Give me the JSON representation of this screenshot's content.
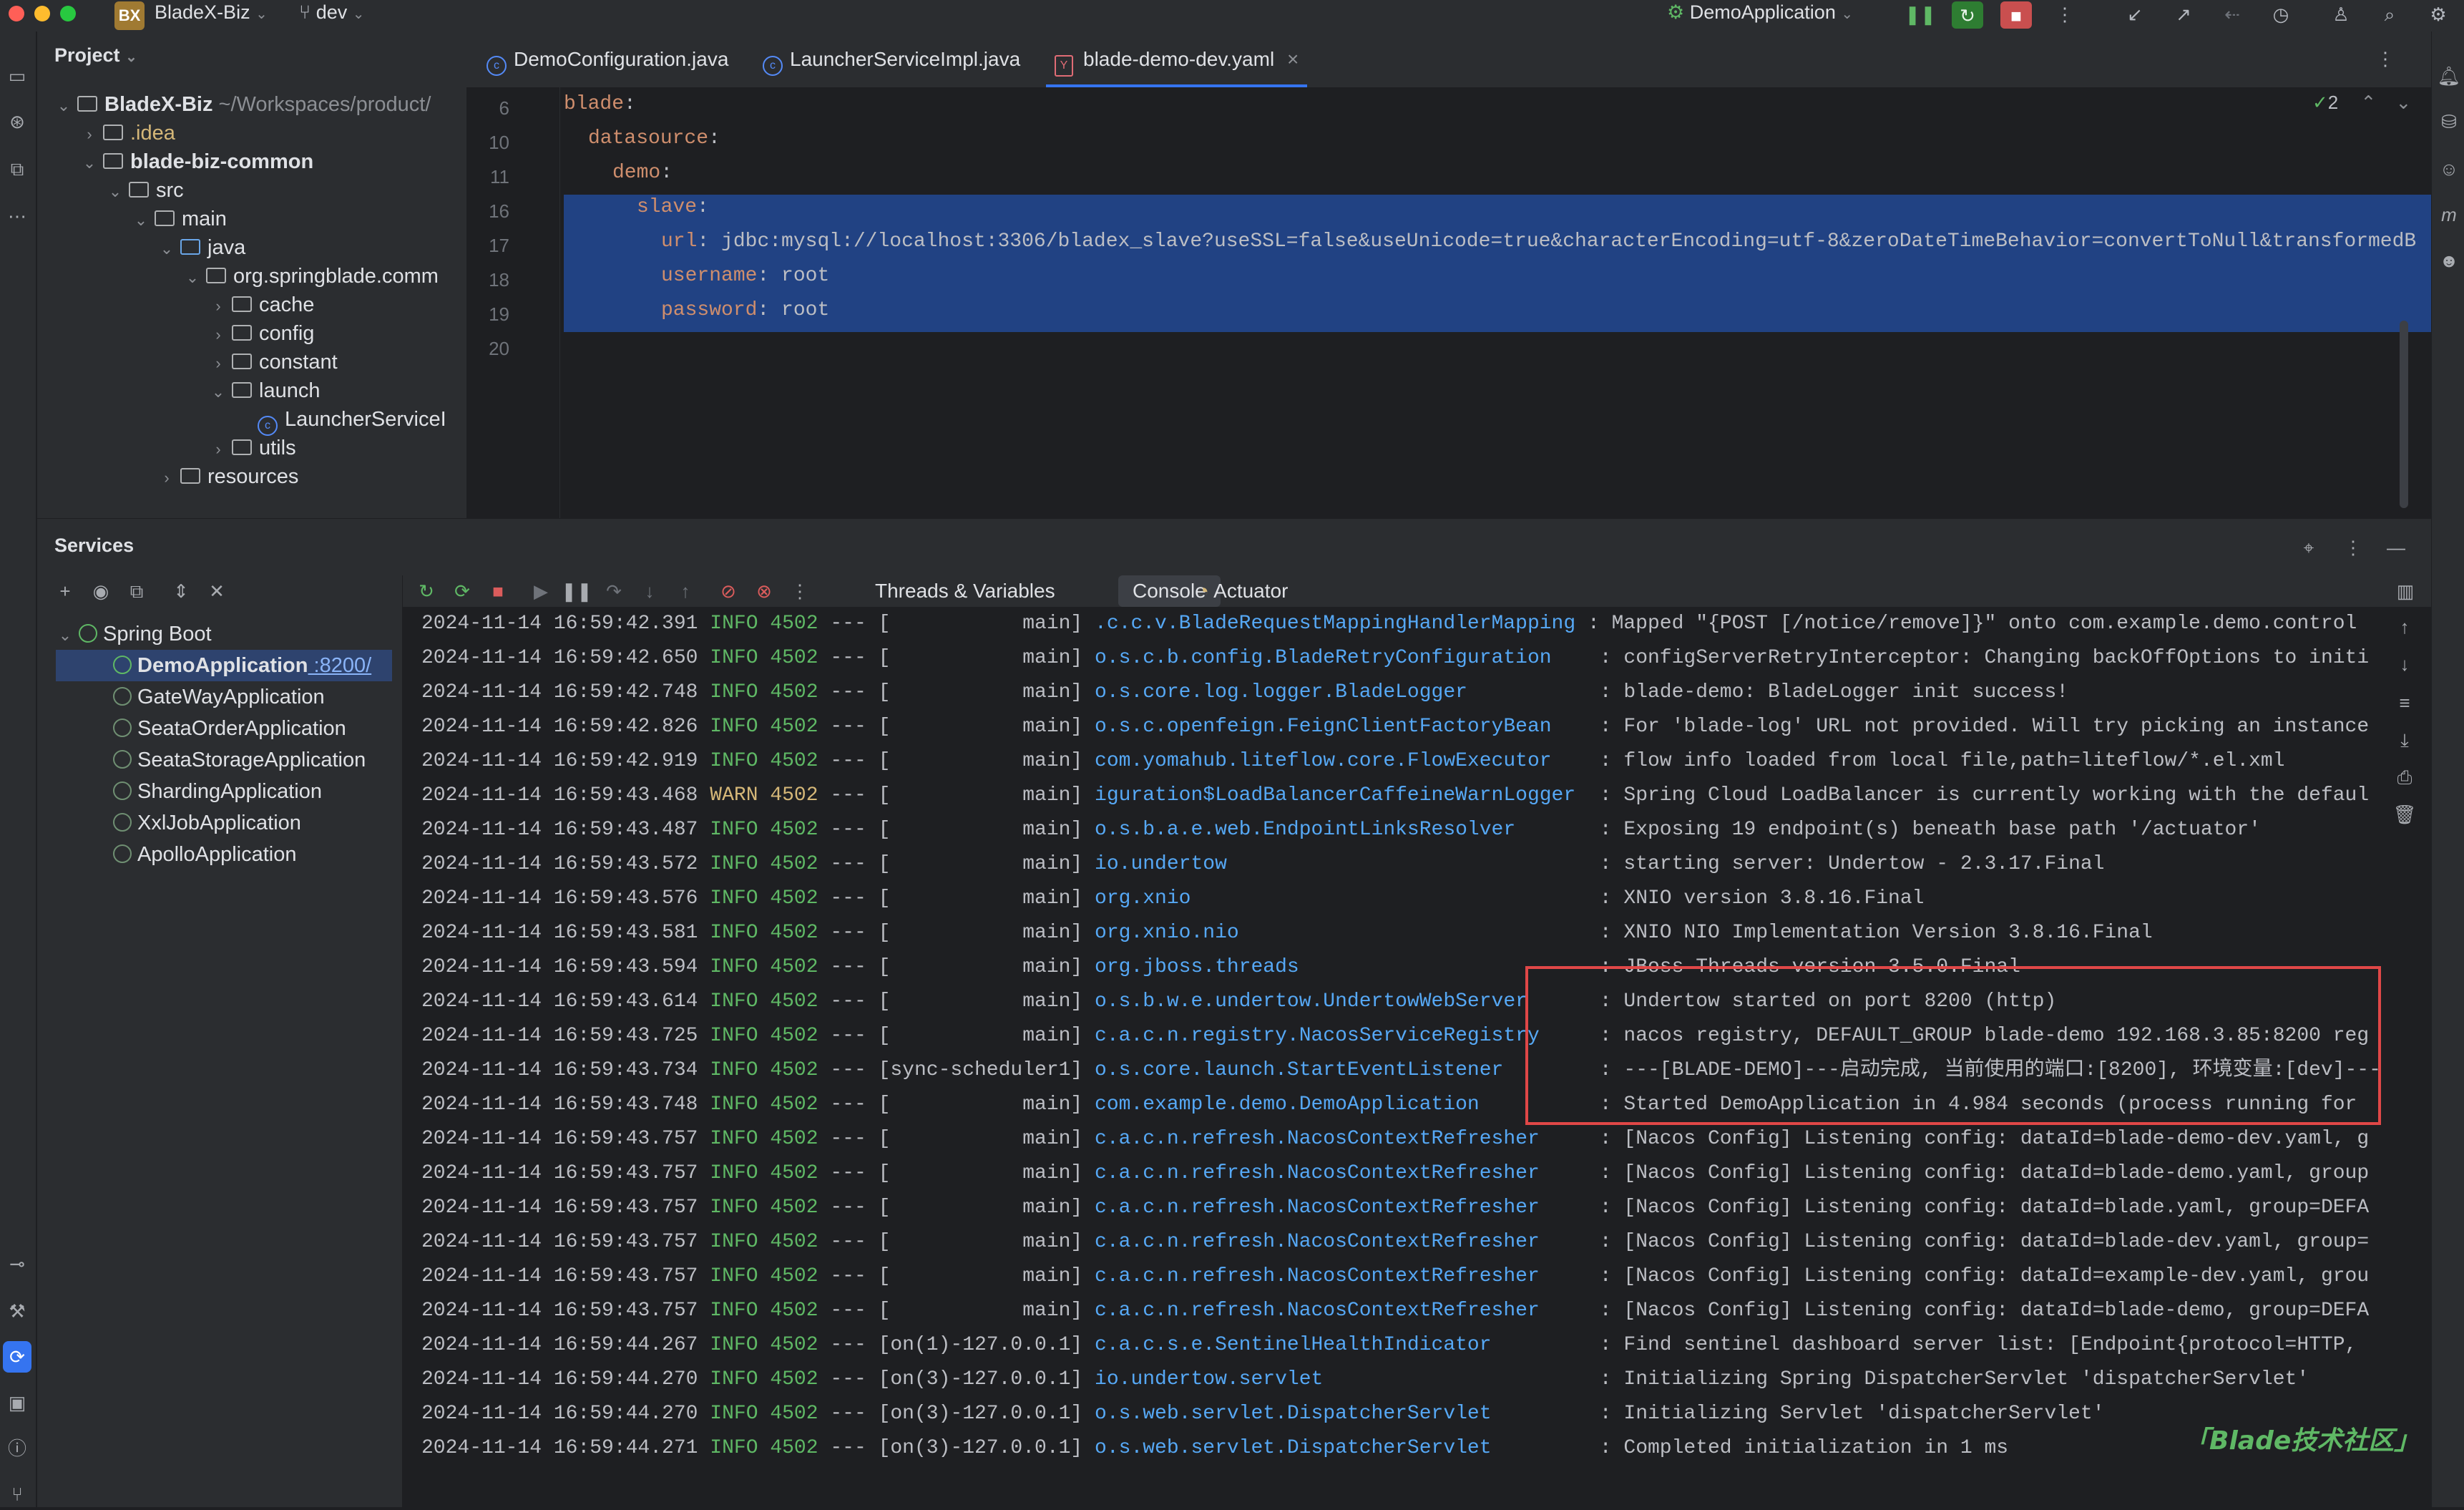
{
  "titlebar": {
    "project_badge": "BX",
    "project_name": "BladeX-Biz",
    "branch": "dev",
    "run_config": "DemoApplication"
  },
  "colors": {
    "accent": "#3574f0",
    "selection": "#214283",
    "info": "#5fb865",
    "warn": "#d5b778",
    "link": "#56a8f5",
    "highlight_box": "#e04747"
  },
  "project": {
    "title": "Project",
    "tree": [
      {
        "label": "BladeX-Biz",
        "suffix": "~/Workspaces/product/",
        "level": 0,
        "kind": "module",
        "expanded": true
      },
      {
        "label": ".idea",
        "level": 1,
        "kind": "folder",
        "expanded": false
      },
      {
        "label": "blade-biz-common",
        "level": 1,
        "kind": "module",
        "expanded": true
      },
      {
        "label": "src",
        "level": 2,
        "kind": "folder",
        "expanded": true
      },
      {
        "label": "main",
        "level": 3,
        "kind": "folder",
        "expanded": true
      },
      {
        "label": "java",
        "level": 4,
        "kind": "source",
        "expanded": true
      },
      {
        "label": "org.springblade.comm",
        "level": 5,
        "kind": "package",
        "expanded": true
      },
      {
        "label": "cache",
        "level": 6,
        "kind": "package",
        "expanded": false
      },
      {
        "label": "config",
        "level": 6,
        "kind": "package",
        "expanded": false
      },
      {
        "label": "constant",
        "level": 6,
        "kind": "package",
        "expanded": false
      },
      {
        "label": "launch",
        "level": 6,
        "kind": "package",
        "expanded": true
      },
      {
        "label": "LauncherServiceI",
        "level": 7,
        "kind": "class",
        "expanded": null
      },
      {
        "label": "utils",
        "level": 6,
        "kind": "package",
        "expanded": false
      },
      {
        "label": "resources",
        "level": 4,
        "kind": "folder",
        "expanded": false
      }
    ]
  },
  "editor": {
    "tabs": [
      {
        "label": "DemoConfiguration.java",
        "active": false
      },
      {
        "label": "LauncherServiceImpl.java",
        "active": false
      },
      {
        "label": "blade-demo-dev.yaml",
        "active": true
      }
    ],
    "inspection_count": "2",
    "lines": [
      {
        "num": "6",
        "key": "blade",
        "value": "",
        "indent": 0,
        "selected": false
      },
      {
        "num": "10",
        "key": "datasource",
        "value": "",
        "indent": 1,
        "selected": false
      },
      {
        "num": "11",
        "key": "demo",
        "value": "",
        "indent": 2,
        "selected": false
      },
      {
        "num": "16",
        "key": "slave",
        "value": "",
        "indent": 3,
        "selected": true
      },
      {
        "num": "17",
        "key": "url",
        "value": "jdbc:mysql://localhost:3306/bladex_slave?useSSL=false&useUnicode=true&characterEncoding=utf-8&zeroDateTimeBehavior=convertToNull&transformedB",
        "indent": 4,
        "selected": true
      },
      {
        "num": "18",
        "key": "username",
        "value": "root",
        "indent": 4,
        "selected": true
      },
      {
        "num": "19",
        "key": "password",
        "value": "root",
        "indent": 4,
        "selected": true
      },
      {
        "num": "20",
        "key": "",
        "value": "",
        "indent": 0,
        "selected": false
      }
    ]
  },
  "services": {
    "title": "Services",
    "group": "Spring Boot",
    "apps": [
      {
        "name": "DemoApplication",
        "port": ":8200/",
        "selected": true,
        "running": true
      },
      {
        "name": "GateWayApplication",
        "port": "",
        "selected": false,
        "running": false
      },
      {
        "name": "SeataOrderApplication",
        "port": "",
        "selected": false,
        "running": false
      },
      {
        "name": "SeataStorageApplication",
        "port": "",
        "selected": false,
        "running": false
      },
      {
        "name": "ShardingApplication",
        "port": "",
        "selected": false,
        "running": false
      },
      {
        "name": "XxlJobApplication",
        "port": "",
        "selected": false,
        "running": false
      },
      {
        "name": "ApolloApplication",
        "port": "",
        "selected": false,
        "running": false
      }
    ],
    "console_tabs": [
      {
        "label": "Threads & Variables",
        "active": false
      },
      {
        "label": "Console",
        "active": true
      },
      {
        "label": "Actuator",
        "active": false
      }
    ]
  },
  "console": {
    "lines": [
      {
        "ts": "2024-11-14 16:59:42.391",
        "level": "INFO",
        "pid": "4502",
        "thread": "[           main]",
        "logger": ".c.c.v.BladeRequestMappingHandlerMapping",
        "msg": ": Mapped \"{POST [/notice/remove]}\" onto com.example.demo.control"
      },
      {
        "ts": "2024-11-14 16:59:42.650",
        "level": "INFO",
        "pid": "4502",
        "thread": "[           main]",
        "logger": "o.s.c.b.config.BladeRetryConfiguration   ",
        "msg": ": configServerRetryInterceptor: Changing backOffOptions to initi"
      },
      {
        "ts": "2024-11-14 16:59:42.748",
        "level": "INFO",
        "pid": "4502",
        "thread": "[           main]",
        "logger": "o.s.core.log.logger.BladeLogger          ",
        "msg": ": blade-demo: BladeLogger init success!"
      },
      {
        "ts": "2024-11-14 16:59:42.826",
        "level": "INFO",
        "pid": "4502",
        "thread": "[           main]",
        "logger": "o.s.c.openfeign.FeignClientFactoryBean   ",
        "msg": ": For 'blade-log' URL not provided. Will try picking an instance"
      },
      {
        "ts": "2024-11-14 16:59:42.919",
        "level": "INFO",
        "pid": "4502",
        "thread": "[           main]",
        "logger": "com.yomahub.liteflow.core.FlowExecutor   ",
        "msg": ": flow info loaded from local file,path=liteflow/*.el.xml"
      },
      {
        "ts": "2024-11-14 16:59:43.468",
        "level": "WARN",
        "pid": "4502",
        "thread": "[           main]",
        "logger": "iguration$LoadBalancerCaffeineWarnLogger ",
        "msg": ": Spring Cloud LoadBalancer is currently working with the defaul"
      },
      {
        "ts": "2024-11-14 16:59:43.487",
        "level": "INFO",
        "pid": "4502",
        "thread": "[           main]",
        "logger": "o.s.b.a.e.web.EndpointLinksResolver      ",
        "msg": ": Exposing 19 endpoint(s) beneath base path '/actuator'"
      },
      {
        "ts": "2024-11-14 16:59:43.572",
        "level": "INFO",
        "pid": "4502",
        "thread": "[           main]",
        "logger": "io.undertow                              ",
        "msg": ": starting server: Undertow - 2.3.17.Final"
      },
      {
        "ts": "2024-11-14 16:59:43.576",
        "level": "INFO",
        "pid": "4502",
        "thread": "[           main]",
        "logger": "org.xnio                                 ",
        "msg": ": XNIO version 3.8.16.Final"
      },
      {
        "ts": "2024-11-14 16:59:43.581",
        "level": "INFO",
        "pid": "4502",
        "thread": "[           main]",
        "logger": "org.xnio.nio                             ",
        "msg": ": XNIO NIO Implementation Version 3.8.16.Final"
      },
      {
        "ts": "2024-11-14 16:59:43.594",
        "level": "INFO",
        "pid": "4502",
        "thread": "[           main]",
        "logger": "org.jboss.threads                        ",
        "msg": ": JBoss Threads version 3.5.0.Final"
      },
      {
        "ts": "2024-11-14 16:59:43.614",
        "level": "INFO",
        "pid": "4502",
        "thread": "[           main]",
        "logger": "o.s.b.w.e.undertow.UndertowWebServer     ",
        "msg": ": Undertow started on port 8200 (http)"
      },
      {
        "ts": "2024-11-14 16:59:43.725",
        "level": "INFO",
        "pid": "4502",
        "thread": "[           main]",
        "logger": "c.a.c.n.registry.NacosServiceRegistry    ",
        "msg": ": nacos registry, DEFAULT_GROUP blade-demo 192.168.3.85:8200 reg"
      },
      {
        "ts": "2024-11-14 16:59:43.734",
        "level": "INFO",
        "pid": "4502",
        "thread": "[sync-scheduler1]",
        "logger": "o.s.core.launch.StartEventListener       ",
        "msg": ": ---[BLADE-DEMO]---启动完成, 当前使用的端口:[8200], 环境变量:[dev]---"
      },
      {
        "ts": "2024-11-14 16:59:43.748",
        "level": "INFO",
        "pid": "4502",
        "thread": "[           main]",
        "logger": "com.example.demo.DemoApplication         ",
        "msg": ": Started DemoApplication in 4.984 seconds (process running for"
      },
      {
        "ts": "2024-11-14 16:59:43.757",
        "level": "INFO",
        "pid": "4502",
        "thread": "[           main]",
        "logger": "c.a.c.n.refresh.NacosContextRefresher    ",
        "msg": ": [Nacos Config] Listening config: dataId=blade-demo-dev.yaml, g"
      },
      {
        "ts": "2024-11-14 16:59:43.757",
        "level": "INFO",
        "pid": "4502",
        "thread": "[           main]",
        "logger": "c.a.c.n.refresh.NacosContextRefresher    ",
        "msg": ": [Nacos Config] Listening config: dataId=blade-demo.yaml, group"
      },
      {
        "ts": "2024-11-14 16:59:43.757",
        "level": "INFO",
        "pid": "4502",
        "thread": "[           main]",
        "logger": "c.a.c.n.refresh.NacosContextRefresher    ",
        "msg": ": [Nacos Config] Listening config: dataId=blade.yaml, group=DEFA"
      },
      {
        "ts": "2024-11-14 16:59:43.757",
        "level": "INFO",
        "pid": "4502",
        "thread": "[           main]",
        "logger": "c.a.c.n.refresh.NacosContextRefresher    ",
        "msg": ": [Nacos Config] Listening config: dataId=blade-dev.yaml, group="
      },
      {
        "ts": "2024-11-14 16:59:43.757",
        "level": "INFO",
        "pid": "4502",
        "thread": "[           main]",
        "logger": "c.a.c.n.refresh.NacosContextRefresher    ",
        "msg": ": [Nacos Config] Listening config: dataId=example-dev.yaml, grou"
      },
      {
        "ts": "2024-11-14 16:59:43.757",
        "level": "INFO",
        "pid": "4502",
        "thread": "[           main]",
        "logger": "c.a.c.n.refresh.NacosContextRefresher    ",
        "msg": ": [Nacos Config] Listening config: dataId=blade-demo, group=DEFA"
      },
      {
        "ts": "2024-11-14 16:59:44.267",
        "level": "INFO",
        "pid": "4502",
        "thread": "[on(1)-127.0.0.1]",
        "logger": "c.a.c.s.e.SentinelHealthIndicator        ",
        "msg": ": Find sentinel dashboard server list: [Endpoint{protocol=HTTP,"
      },
      {
        "ts": "2024-11-14 16:59:44.270",
        "level": "INFO",
        "pid": "4502",
        "thread": "[on(3)-127.0.0.1]",
        "logger": "io.undertow.servlet                      ",
        "msg": ": Initializing Spring DispatcherServlet 'dispatcherServlet'"
      },
      {
        "ts": "2024-11-14 16:59:44.270",
        "level": "INFO",
        "pid": "4502",
        "thread": "[on(3)-127.0.0.1]",
        "logger": "o.s.web.servlet.DispatcherServlet        ",
        "msg": ": Initializing Servlet 'dispatcherServlet'"
      },
      {
        "ts": "2024-11-14 16:59:44.271",
        "level": "INFO",
        "pid": "4502",
        "thread": "[on(3)-127.0.0.1]",
        "logger": "o.s.web.servlet.DispatcherServlet        ",
        "msg": ": Completed initialization in 1 ms"
      }
    ]
  },
  "watermark": "「Blade技术社区」"
}
